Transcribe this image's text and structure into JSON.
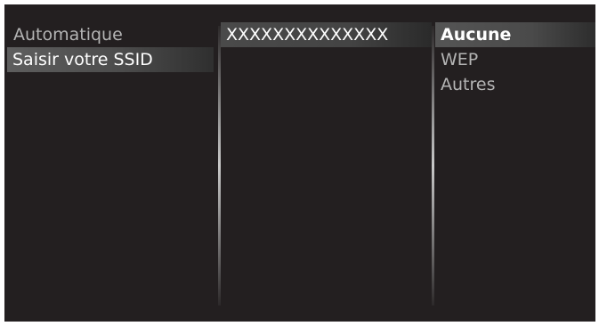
{
  "column1": {
    "items": [
      {
        "label": "Automatique"
      },
      {
        "label": "Saisir votre SSID"
      }
    ]
  },
  "column2": {
    "items": [
      {
        "label": "XXXXXXXXXXXXXX"
      }
    ]
  },
  "column3": {
    "items": [
      {
        "label": "Aucune"
      },
      {
        "label": "WEP"
      },
      {
        "label": "Autres"
      }
    ]
  }
}
